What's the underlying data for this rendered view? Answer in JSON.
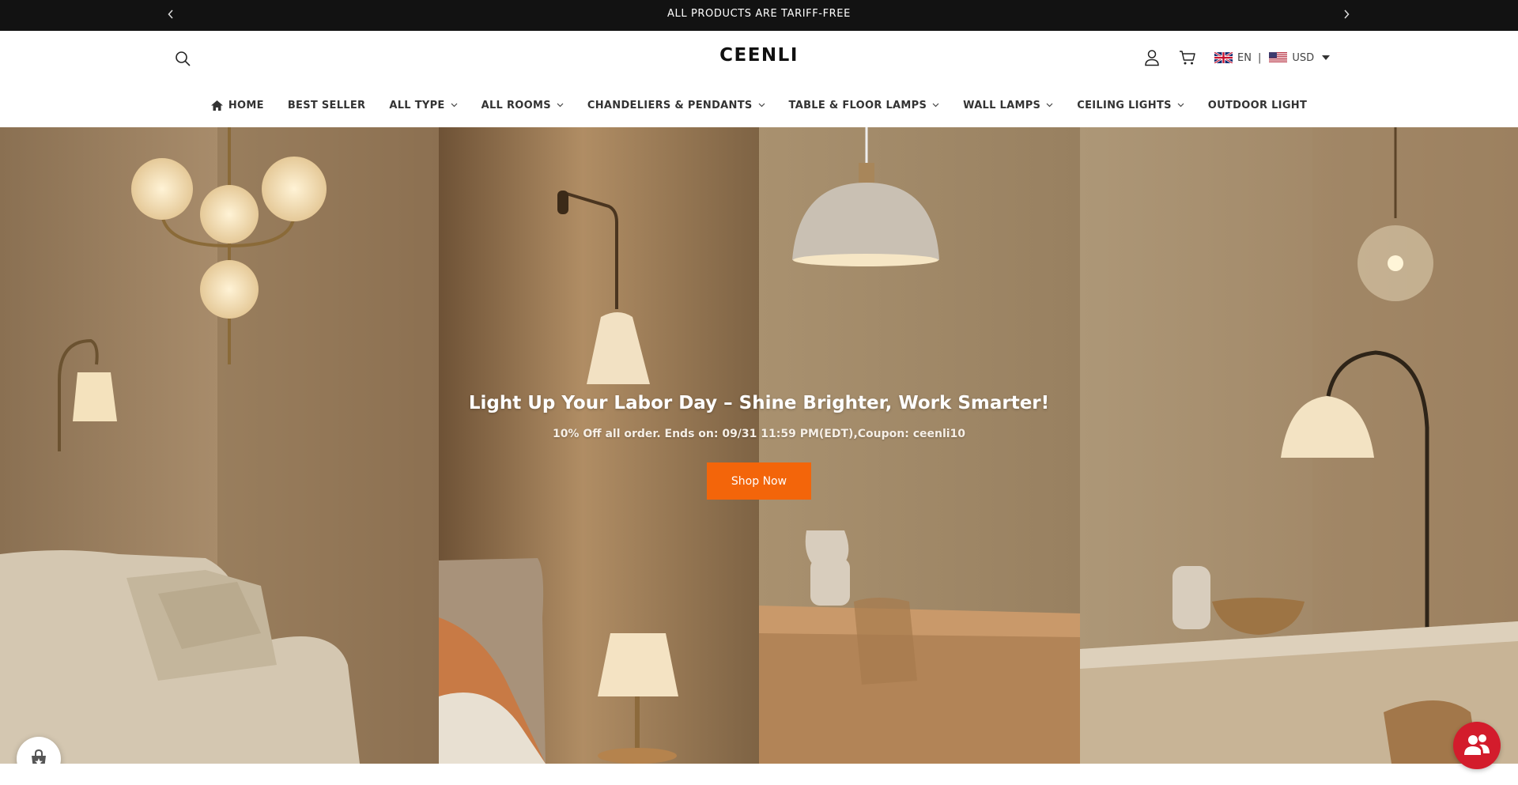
{
  "announcement": {
    "message": "ALL PRODUCTS ARE TARIFF-FREE",
    "prev_icon": "chevron-left-icon",
    "next_icon": "chevron-right-icon"
  },
  "header": {
    "logo": "CEENLI",
    "search_icon": "search-icon",
    "account_icon": "account-icon",
    "cart_icon": "cart-icon",
    "language": "EN",
    "currency": "USD",
    "locale_separator": "|"
  },
  "nav": {
    "home": "HOME",
    "best_seller": "BEST SELLER",
    "all_type": "ALL TYPE",
    "all_rooms": "ALL ROOMS",
    "chandeliers": "CHANDELIERS & PENDANTS",
    "table_floor": "TABLE & FLOOR LAMPS",
    "wall_lamps": "WALL LAMPS",
    "ceiling_lights": "CEILING LIGHTS",
    "outdoor_light": "OUTDOOR LIGHT"
  },
  "hero": {
    "title": "Light Up Your Labor Day – Shine Brighter, Work Smarter!",
    "subtitle": "10% Off all order. Ends on: 09/31 11:59 PM(EDT),Coupon: ceenli10",
    "cta": "Shop Now",
    "cta_color": "#f3650a"
  },
  "widgets": {
    "rewards_icon": "rewards-icon",
    "chat_icon": "chat-icon",
    "chat_color": "#d31c2c"
  }
}
